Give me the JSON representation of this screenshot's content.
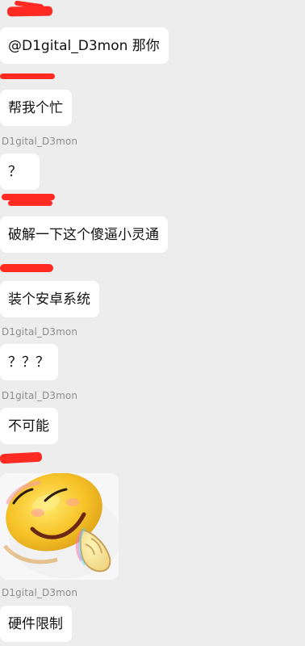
{
  "messages": [
    {
      "type": "text",
      "text": "@D1gital_D3mon 那你"
    },
    {
      "type": "text",
      "text": "帮我个忙"
    },
    {
      "type": "sender",
      "text": "D1gital_D3mon"
    },
    {
      "type": "text",
      "text": "？"
    },
    {
      "type": "text",
      "text": "破解一下这个傻逼小灵通"
    },
    {
      "type": "text",
      "text": "装个安卓系统"
    },
    {
      "type": "sender",
      "text": "D1gital_D3mon"
    },
    {
      "type": "text",
      "text": "？？？"
    },
    {
      "type": "sender",
      "text": "D1gital_D3mon"
    },
    {
      "type": "text",
      "text": "不可能"
    },
    {
      "type": "sticker",
      "icon": "smiley-face-icon"
    },
    {
      "type": "sender",
      "text": "D1gital_D3mon"
    },
    {
      "type": "text",
      "text": "硬件限制"
    }
  ],
  "colors": {
    "background": "#ededed",
    "bubble": "#ffffff",
    "redaction": "#ff2a22",
    "sender": "#8d8d8d"
  }
}
